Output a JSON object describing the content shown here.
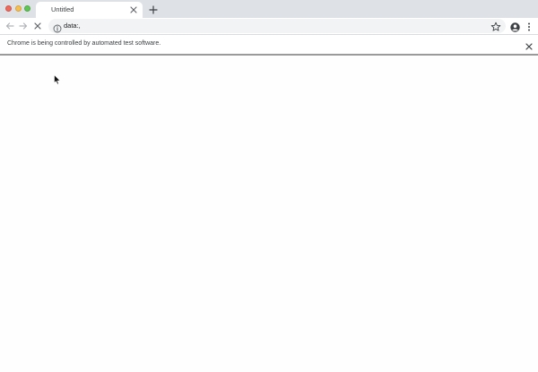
{
  "window": {
    "traffic_lights": [
      "close",
      "minimize",
      "zoom"
    ]
  },
  "tabs": [
    {
      "title": "Untitled",
      "active": true,
      "close_icon": "close-icon"
    }
  ],
  "new_tab_icon": "plus-icon",
  "toolbar": {
    "back_icon": "arrow-left-icon",
    "forward_icon": "arrow-right-icon",
    "stop_icon": "stop-x-icon",
    "address": {
      "value": "data:,",
      "security_icon": "info-icon",
      "bookmark_icon": "star-icon"
    },
    "profile_icon": "account-circle-icon",
    "menu_icon": "kebab-menu-icon"
  },
  "infobar": {
    "message": "Chrome is being controlled by automated test software.",
    "close_icon": "close-icon"
  },
  "colors": {
    "tabstrip": "#dee1e6",
    "omnibox": "#f1f3f4",
    "text": "#3c4043",
    "close_red": "#ed6a5e",
    "minimize_yellow": "#f5bf4f",
    "zoom_green": "#61c554"
  }
}
